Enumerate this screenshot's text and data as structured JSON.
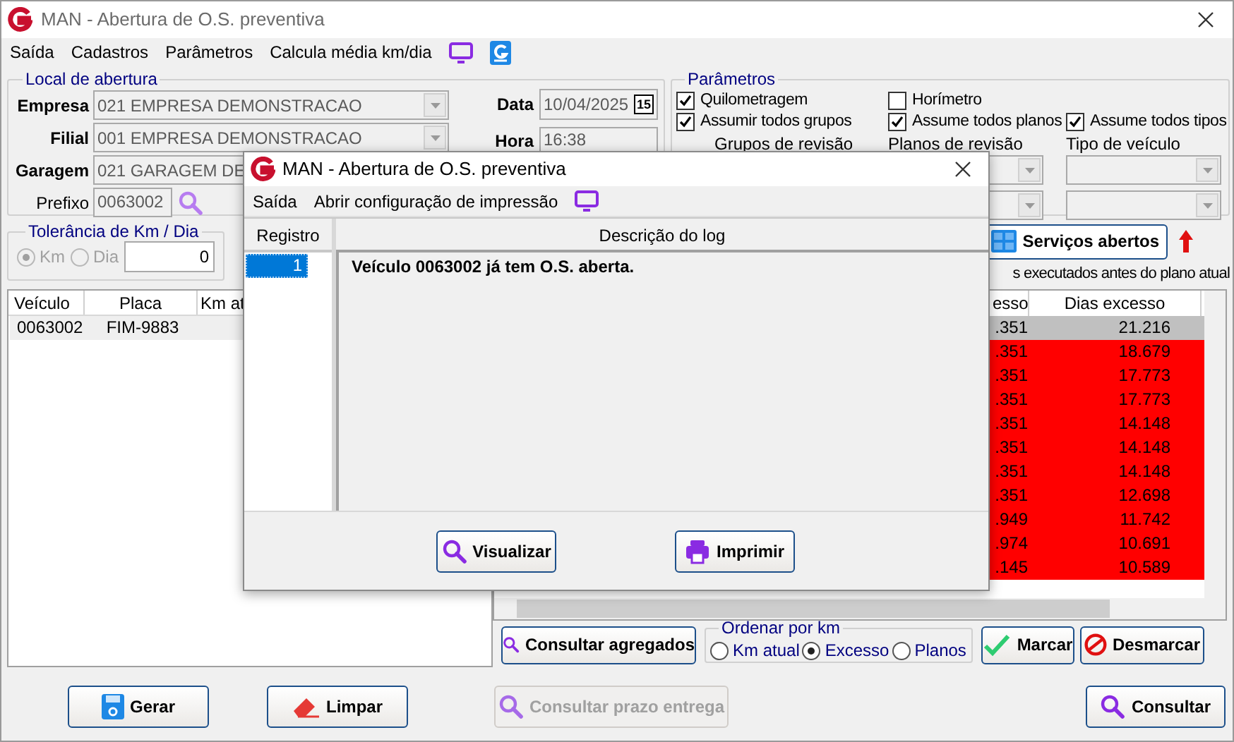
{
  "window": {
    "title": "MAN - Abertura de O.S. preventiva"
  },
  "menu": [
    "Saída",
    "Cadastros",
    "Parâmetros",
    "Calcula média km/dia"
  ],
  "local_de_abertura": {
    "title": "Local de abertura",
    "fields": [
      {
        "label": "Empresa",
        "value": "021 EMPRESA DEMONSTRACAO"
      },
      {
        "label": "Filial",
        "value": "001 EMPRESA DEMONSTRACAO"
      },
      {
        "label": "Garagem",
        "value": "021 GARAGEM DE"
      }
    ],
    "prefixo": {
      "label": "Prefixo",
      "value": "0063002"
    },
    "data": {
      "label": "Data",
      "value": "10/04/2025",
      "calendar": "15"
    },
    "hora": {
      "label": "Hora",
      "value": "16:38"
    }
  },
  "parametros": {
    "title": "Parâmetros",
    "columns": [
      {
        "checks": [
          {
            "label": "Quilometragem",
            "checked": true
          },
          {
            "label": "Assumir todos grupos",
            "checked": true
          }
        ],
        "list_label": "Grupos de revisão"
      },
      {
        "checks": [
          {
            "label": "Horímetro",
            "checked": false
          },
          {
            "label": "Assume todos planos",
            "checked": true
          }
        ],
        "list_label": "Planos de revisão"
      },
      {
        "checks": [
          {
            "label": "Assume todos tipos",
            "checked": true
          }
        ],
        "list_label": "Tipo de veículo"
      }
    ]
  },
  "tolerancia": {
    "title": "Tolerância de Km / Dia",
    "options": [
      {
        "label": "Km",
        "selected": true
      },
      {
        "label": "Dia",
        "selected": false
      }
    ],
    "value": "0"
  },
  "servicos_abertos_button": {
    "label": "Serviços abertos"
  },
  "executados_label": "s executados antes do plano atual",
  "vehicles_table": {
    "columns": [
      "Veículo",
      "Placa",
      "Km at"
    ],
    "rows": [
      [
        "0063002",
        "FIM-9883"
      ]
    ]
  },
  "excess_table": {
    "columns": [
      "esso",
      "Dias excesso"
    ],
    "rows": [
      {
        "cells": [
          ".351",
          "21.216"
        ],
        "selected": true
      },
      {
        "cells": [
          ".351",
          "18.679"
        ],
        "selected": false
      },
      {
        "cells": [
          ".351",
          "17.773"
        ],
        "selected": false
      },
      {
        "cells": [
          ".351",
          "17.773"
        ],
        "selected": false
      },
      {
        "cells": [
          ".351",
          "14.148"
        ],
        "selected": false
      },
      {
        "cells": [
          ".351",
          "14.148"
        ],
        "selected": false
      },
      {
        "cells": [
          ".351",
          "14.148"
        ],
        "selected": false
      },
      {
        "cells": [
          ".351",
          "12.698"
        ],
        "selected": false
      },
      {
        "cells": [
          ".949",
          "11.742"
        ],
        "selected": false
      },
      {
        "cells": [
          ".974",
          "10.691"
        ],
        "selected": false
      },
      {
        "cells": [
          ".145",
          "10.589"
        ],
        "selected": false
      }
    ]
  },
  "consultar_agregados_button": {
    "label": "Consultar agregados"
  },
  "ordenar": {
    "title": "Ordenar por km",
    "options": [
      {
        "label": "Km atual",
        "selected": false
      },
      {
        "label": "Excesso",
        "selected": true
      },
      {
        "label": "Planos",
        "selected": false
      }
    ]
  },
  "marcar_button": {
    "label": "Marcar"
  },
  "desmarcar_button": {
    "label": "Desmarcar"
  },
  "gerar_button": {
    "label": "Gerar"
  },
  "limpar_button": {
    "label": "Limpar"
  },
  "consultar_prazo_button": {
    "label": "Consultar prazo entrega",
    "disabled": true
  },
  "consultar_button": {
    "label": "Consultar"
  },
  "dialog": {
    "title": "MAN - Abertura de O.S. preventiva",
    "menu": [
      "Saída",
      "Abrir configuração de impressão"
    ],
    "columns": [
      "Registro",
      "Descrição do log"
    ],
    "rows": [
      {
        "registro": "1",
        "descricao": "Veículo 0063002 já tem O.S. aberta.",
        "selected": true
      }
    ],
    "visualizar_button": {
      "label": "Visualizar"
    },
    "imprimir_button": {
      "label": "Imprimir"
    }
  }
}
